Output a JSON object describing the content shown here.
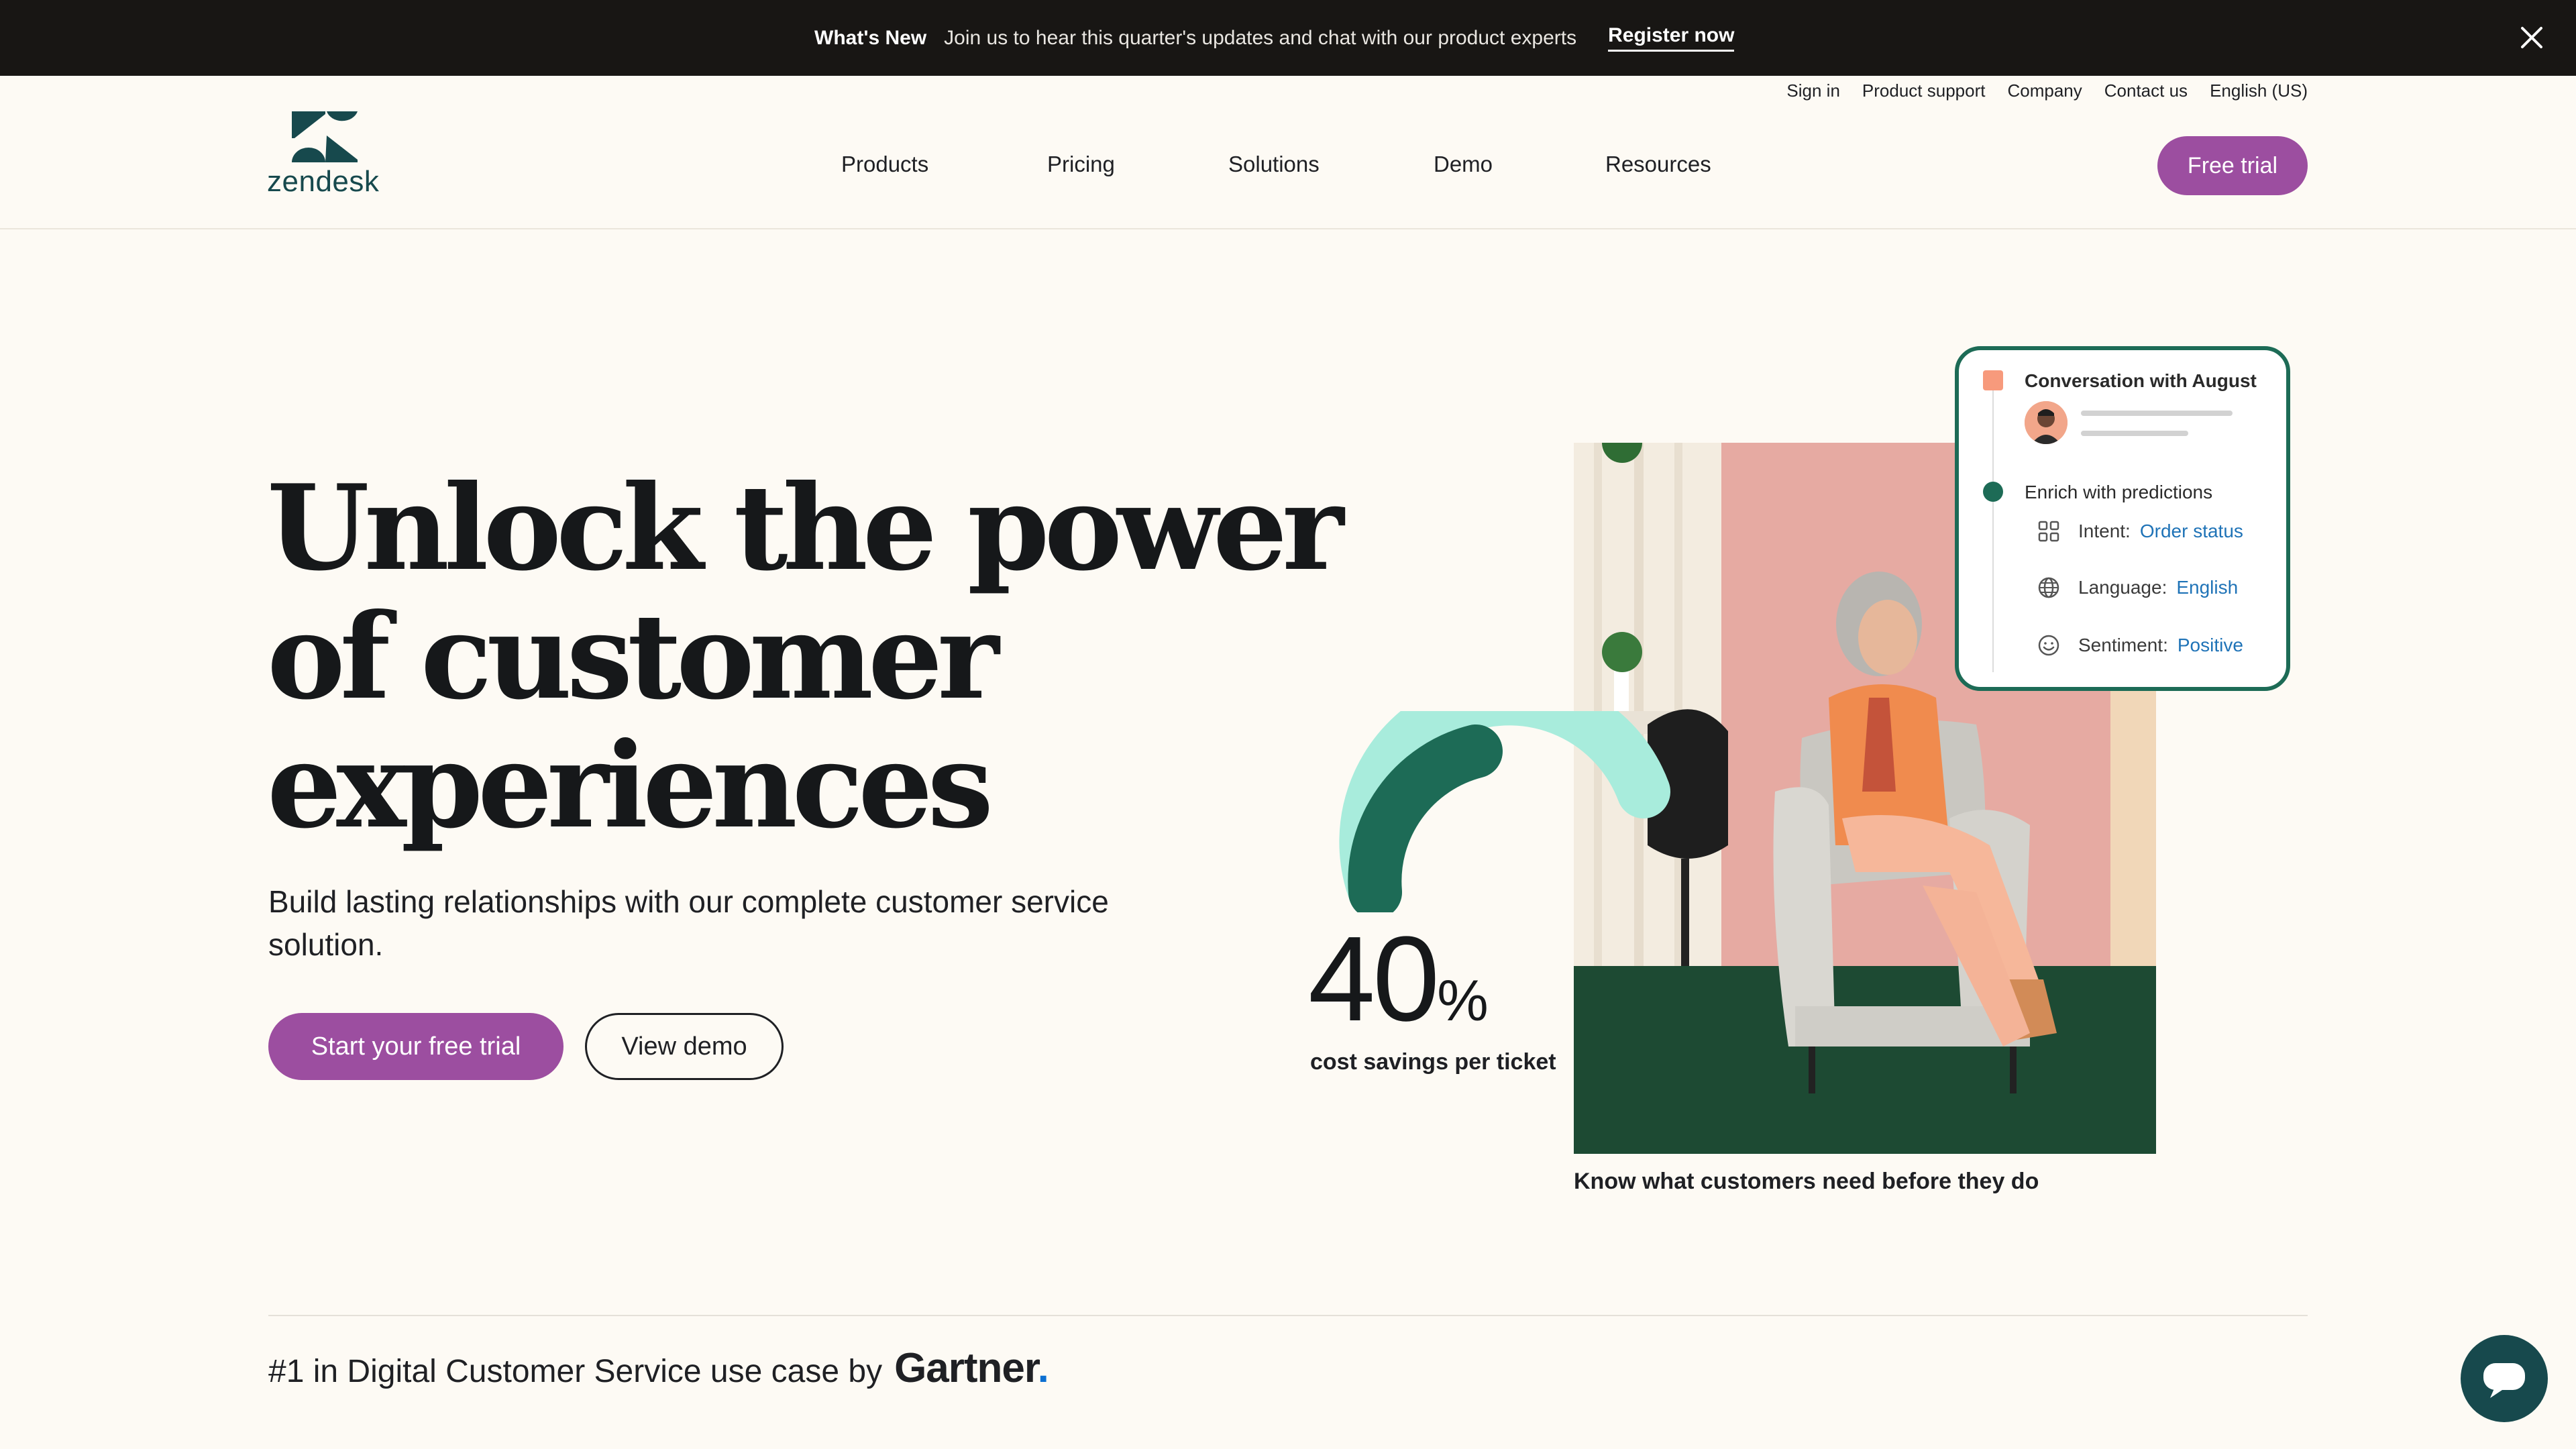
{
  "announcement": {
    "label": "What's New",
    "message": "Join us to hear this quarter's updates and chat with our product experts",
    "link": "Register now"
  },
  "utility_nav": [
    "Sign in",
    "Product support",
    "Company",
    "Contact us",
    "English (US)"
  ],
  "logo": {
    "wordmark": "zendesk"
  },
  "nav": {
    "items": [
      "Products",
      "Pricing",
      "Solutions",
      "Demo",
      "Resources"
    ],
    "cta": "Free trial"
  },
  "hero": {
    "title_lines": [
      "Unlock the power",
      "of customer",
      "experiences"
    ],
    "subtitle": "Build lasting relationships with our complete customer service solution.",
    "primary_button": "Start your free trial",
    "secondary_button": "View demo"
  },
  "stat": {
    "value": "40",
    "unit": "%",
    "caption": "cost savings per ticket"
  },
  "photo_caption": "Know what customers need before they do",
  "conversation_card": {
    "title": "Conversation with August",
    "step2": "Enrich with predictions",
    "predictions": [
      {
        "label": "Intent:",
        "value": "Order status",
        "icon": "grid-icon"
      },
      {
        "label": "Language:",
        "value": "English",
        "icon": "globe-icon"
      },
      {
        "label": "Sentiment:",
        "value": "Positive",
        "icon": "smiley-icon"
      }
    ]
  },
  "gartner": {
    "text": "#1 in Digital Customer Service use case by",
    "brand": "Gartner",
    "brand_dot": "."
  },
  "colors": {
    "background": "#fdfaf4",
    "topbar": "#181614",
    "accent_purple": "#9c4ea0",
    "accent_green": "#1d6b56",
    "arc_light": "#a8ecdc",
    "link_blue": "#1f73b7"
  }
}
